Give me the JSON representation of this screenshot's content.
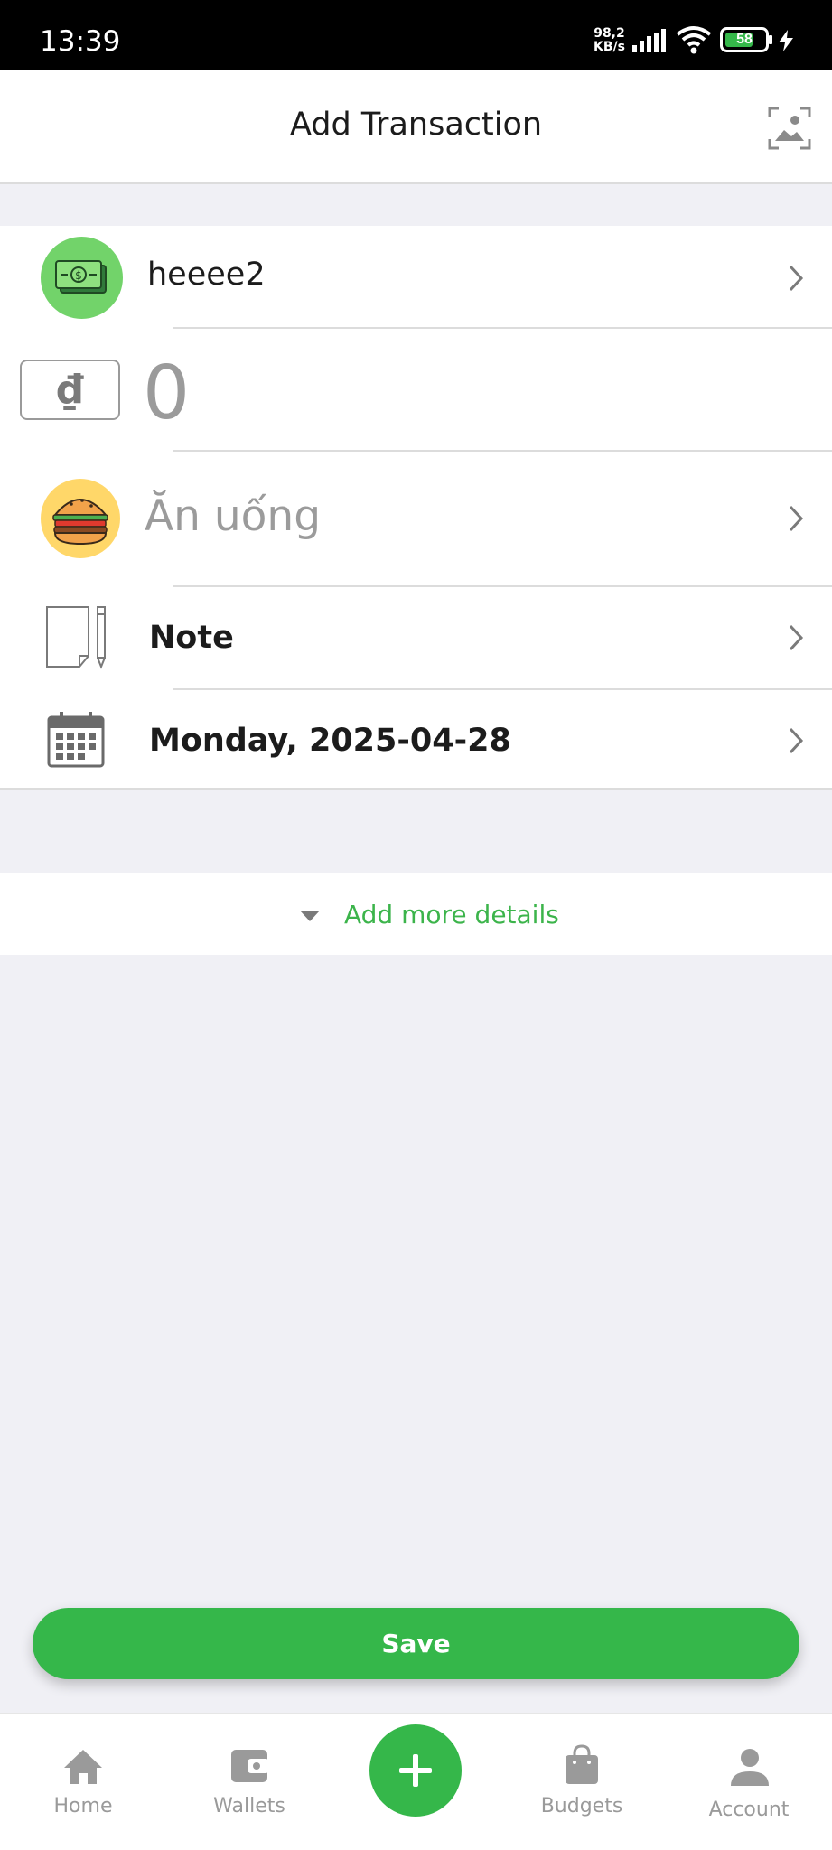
{
  "status_bar": {
    "time": "13:39",
    "net_speed_value": "98,2",
    "net_speed_unit": "KB/s",
    "battery": "58"
  },
  "header": {
    "title": "Add Transaction",
    "scan_icon": "image-scan-icon"
  },
  "form": {
    "wallet": {
      "name": "heeee2",
      "icon": "money-icon"
    },
    "amount": {
      "currency_symbol": "₫",
      "value": "0"
    },
    "category": {
      "placeholder": "Ăn uống",
      "icon": "burger-icon"
    },
    "note": {
      "label": "Note",
      "icon": "notepad-icon"
    },
    "date": {
      "label": "Monday, 2025-04-28",
      "icon": "calendar-icon"
    }
  },
  "more_details": {
    "label": "Add more details"
  },
  "save_button": {
    "label": "Save"
  },
  "bottom_nav": {
    "items": [
      {
        "label": "Home",
        "icon": "home-icon"
      },
      {
        "label": "Wallets",
        "icon": "wallet-icon"
      },
      {
        "label": "",
        "icon": "plus-icon"
      },
      {
        "label": "Budgets",
        "icon": "bag-icon"
      },
      {
        "label": "Account",
        "icon": "person-icon"
      }
    ]
  },
  "colors": {
    "accent": "#35b74a",
    "link": "#3cb44b",
    "background": "#f0f0f5",
    "wallet_circle": "#72d36a",
    "food_circle": "#ffd769"
  }
}
